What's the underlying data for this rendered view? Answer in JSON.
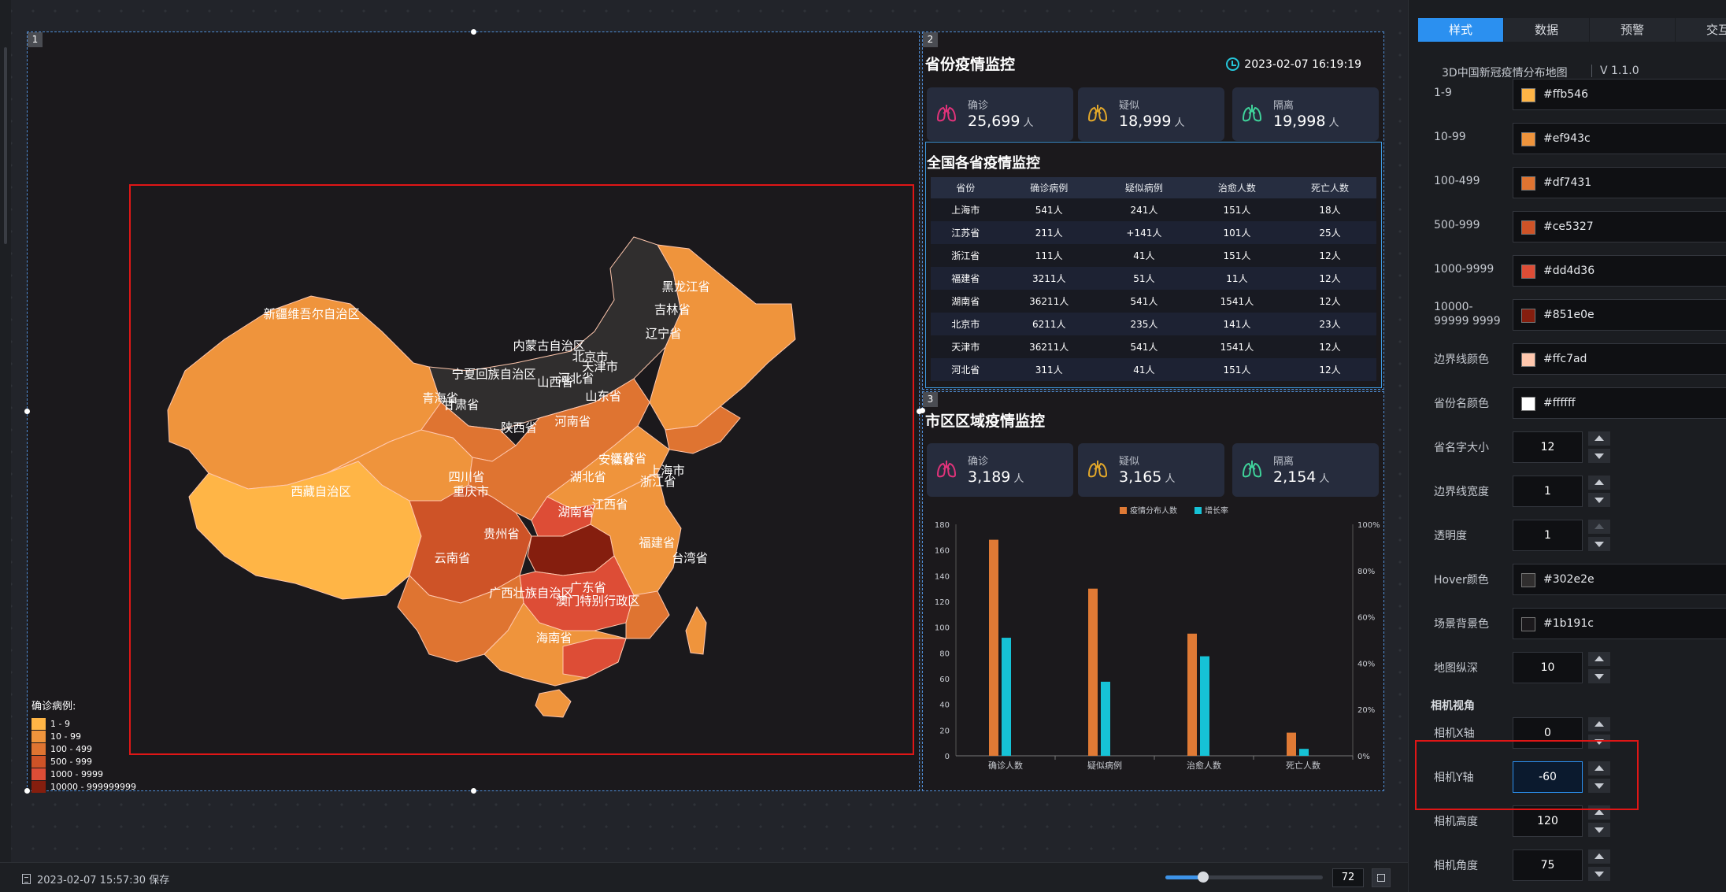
{
  "canvas": {
    "widgets": [
      {
        "num": "1"
      },
      {
        "num": "2"
      },
      {
        "num": "3"
      }
    ]
  },
  "map": {
    "legend_title": "确诊病例:",
    "legend": [
      {
        "label": "1 - 9",
        "color": "#ffb546"
      },
      {
        "label": "10 - 99",
        "color": "#ef943c"
      },
      {
        "label": "100 - 499",
        "color": "#df7431"
      },
      {
        "label": "500 - 999",
        "color": "#ce5327"
      },
      {
        "label": "1000 - 9999",
        "color": "#dd4d36"
      },
      {
        "label": "10000 - 999999999",
        "color": "#851e0e"
      }
    ],
    "province_labels": [
      "新疆维吾尔自治区",
      "西藏自治区",
      "青海省",
      "甘肃省",
      "内蒙古自治区",
      "黑龙江省",
      "吉林省",
      "辽宁省",
      "北京市",
      "天津市",
      "河北省",
      "山西省",
      "山东省",
      "宁夏回族自治区",
      "陕西省",
      "河南省",
      "江苏省",
      "安徽省",
      "上海市",
      "浙江省",
      "湖北省",
      "四川省",
      "重庆市",
      "贵州省",
      "湖南省",
      "江西省",
      "福建省",
      "台湾省",
      "云南省",
      "广西壮族自治区",
      "广东省",
      "澳门特别行政区",
      "海南省"
    ]
  },
  "province_widget": {
    "title": "省份疫情监控",
    "datetime": "2023-02-07  16:19:19",
    "stats": [
      {
        "label": "确诊",
        "value": "25,699",
        "unit": "人",
        "icon": "lung-icon",
        "color": "#e0337a"
      },
      {
        "label": "疑似",
        "value": "18,999",
        "unit": "人",
        "icon": "lung-icon",
        "color": "#e3a82a"
      },
      {
        "label": "隔离",
        "value": "19,998",
        "unit": "人",
        "icon": "lung-icon",
        "color": "#3fd29a"
      }
    ],
    "table_title": "全国各省疫情监控",
    "columns": [
      "省份",
      "确诊病例",
      "疑似病例",
      "治愈人数",
      "死亡人数"
    ],
    "rows": [
      [
        "上海市",
        "541人",
        "241人",
        "151人",
        "18人"
      ],
      [
        "江苏省",
        "211人",
        "+141人",
        "101人",
        "25人"
      ],
      [
        "浙江省",
        "111人",
        "41人",
        "151人",
        "12人"
      ],
      [
        "福建省",
        "3211人",
        "51人",
        "11人",
        "12人"
      ],
      [
        "湖南省",
        "36211人",
        "541人",
        "1541人",
        "12人"
      ],
      [
        "北京市",
        "6211人",
        "235人",
        "141人",
        "23人"
      ],
      [
        "天津市",
        "36211人",
        "541人",
        "1541人",
        "12人"
      ],
      [
        "河北省",
        "311人",
        "41人",
        "151人",
        "12人"
      ]
    ]
  },
  "city_widget": {
    "title": "市区区域疫情监控",
    "stats": [
      {
        "label": "确诊",
        "value": "3,189",
        "unit": "人",
        "icon": "lung-icon",
        "color": "#e0337a"
      },
      {
        "label": "疑似",
        "value": "3,165",
        "unit": "人",
        "icon": "lung-icon",
        "color": "#e3a82a"
      },
      {
        "label": "隔离",
        "value": "2,154",
        "unit": "人",
        "icon": "lung-icon",
        "color": "#3fd29a"
      }
    ]
  },
  "chart_data": {
    "type": "bar",
    "categories": [
      "确诊人数",
      "疑似病例",
      "治愈人数",
      "死亡人数"
    ],
    "series": [
      {
        "name": "疫情分布人数",
        "axis": "left",
        "color": "#e07a35",
        "values": [
          168,
          130,
          95,
          18
        ]
      },
      {
        "name": "增长率",
        "axis": "right",
        "color": "#16c2d6",
        "values": [
          51,
          32,
          43,
          3
        ]
      }
    ],
    "y_left": {
      "min": 0,
      "max": 180,
      "ticks": [
        0,
        20,
        40,
        60,
        80,
        100,
        120,
        140,
        160,
        180
      ]
    },
    "y_right": {
      "min": 0,
      "max": 100,
      "ticks": [
        "0%",
        "20%",
        "40%",
        "60%",
        "80%",
        "100%"
      ]
    },
    "legend_position": "top-center"
  },
  "bottom_bar": {
    "save_text": "2023-02-07 15:57:30 保存",
    "zoom": "72",
    "zoom_fraction": 0.24
  },
  "panel": {
    "tabs": [
      "样式",
      "数据",
      "预警",
      "交互"
    ],
    "active_tab": 0,
    "component_name": "3D中国新冠疫情分布地图",
    "version": "V 1.1.0",
    "color_rows": [
      {
        "label": "1-9",
        "value": "#ffb546"
      },
      {
        "label": "10-99",
        "value": "#ef943c"
      },
      {
        "label": "100-499",
        "value": "#df7431"
      },
      {
        "label": "500-999",
        "value": "#ce5327"
      },
      {
        "label": "1000-9999",
        "value": "#dd4d36"
      },
      {
        "label": "10000-99999 9999",
        "value": "#851e0e"
      },
      {
        "label": "边界线颜色",
        "value": "#ffc7ad"
      },
      {
        "label": "省份名颜色",
        "value": "#ffffff"
      }
    ],
    "num_rows_a": [
      {
        "label": "省名字大小",
        "value": "12"
      },
      {
        "label": "边界线宽度",
        "value": "1"
      },
      {
        "label": "透明度",
        "value": "1"
      }
    ],
    "color_rows_b": [
      {
        "label": "Hover颜色",
        "value": "#302e2e"
      },
      {
        "label": "场景背景色",
        "value": "#1b191c"
      }
    ],
    "depth": {
      "label": "地图纵深",
      "value": "10"
    },
    "camera_section": "相机视角",
    "camera_rows": [
      {
        "label": "相机X轴",
        "value": "0"
      },
      {
        "label": "相机Y轴",
        "value": "-60"
      },
      {
        "label": "相机高度",
        "value": "120"
      },
      {
        "label": "相机角度",
        "value": "75"
      }
    ]
  }
}
